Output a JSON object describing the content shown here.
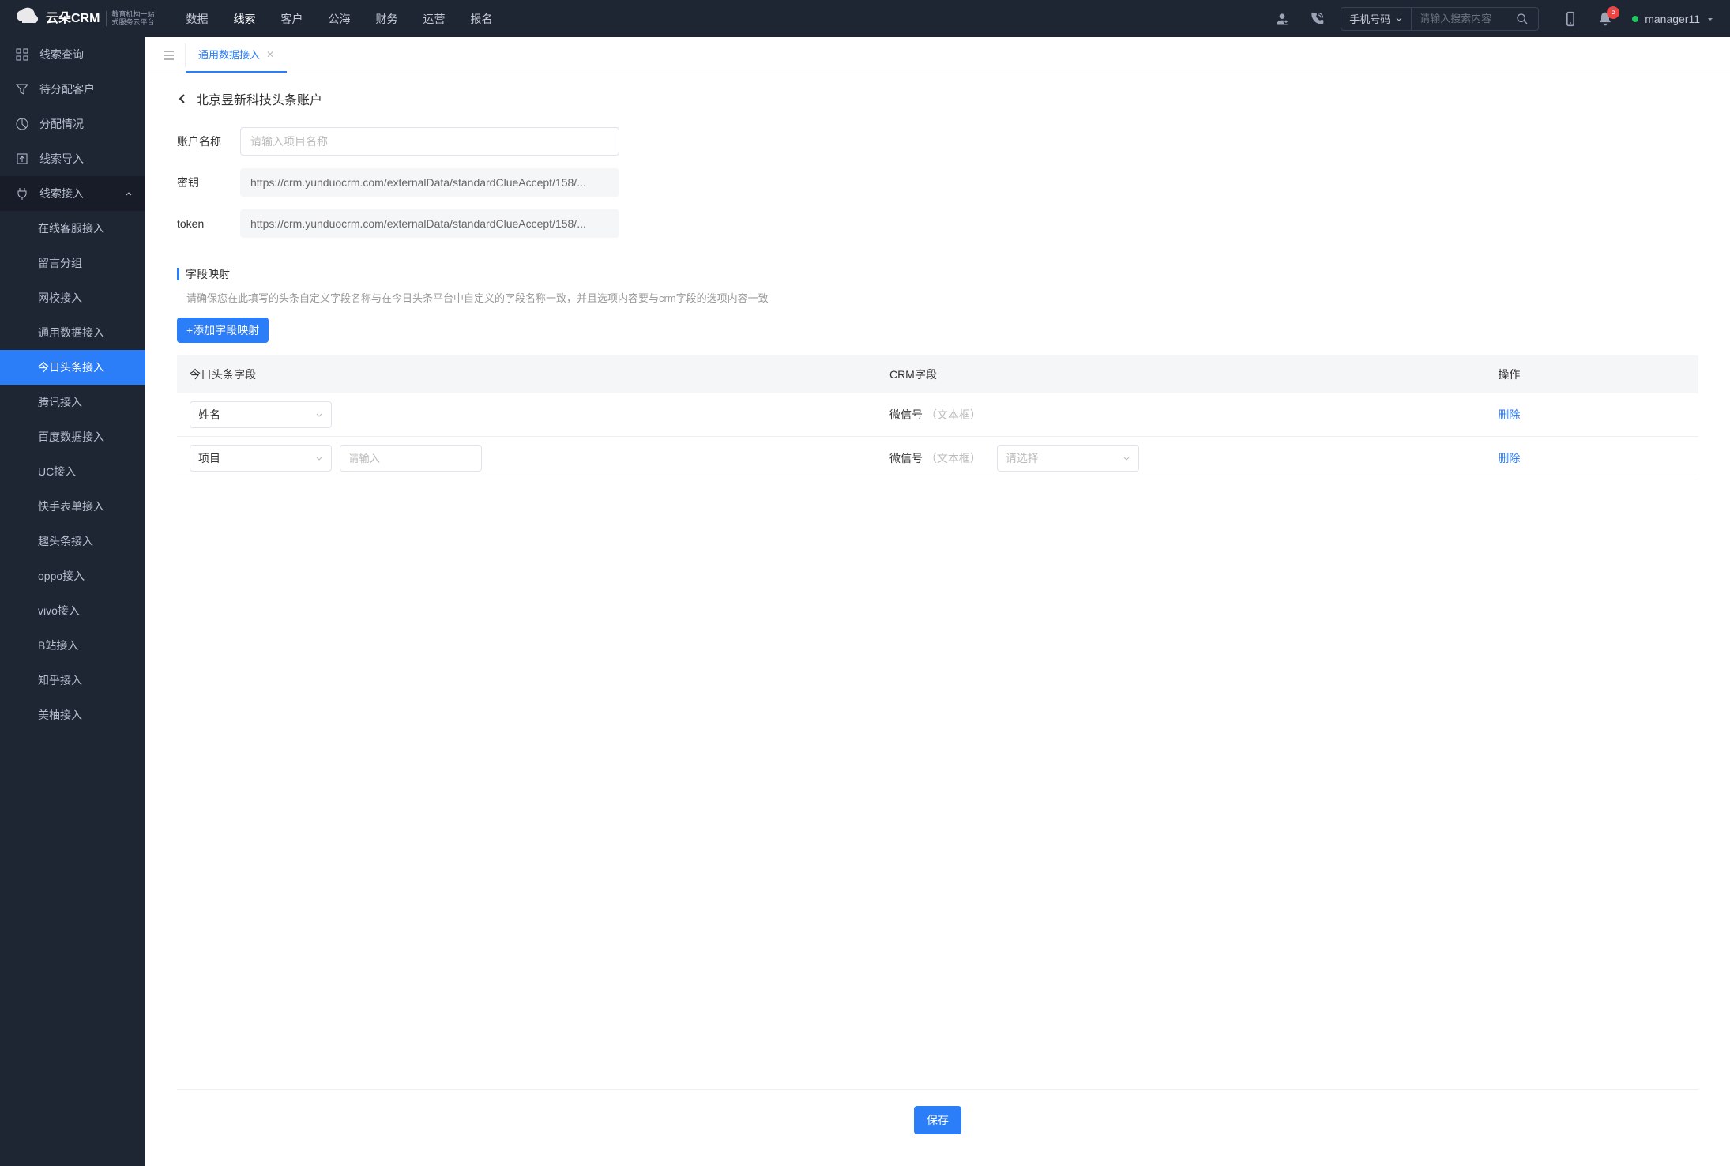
{
  "header": {
    "logo_main": "云朵CRM",
    "logo_sub1": "教育机构一站",
    "logo_sub2": "式服务云平台",
    "nav": [
      "数据",
      "线索",
      "客户",
      "公海",
      "财务",
      "运营",
      "报名"
    ],
    "nav_active": 1,
    "search_select": "手机号码",
    "search_placeholder": "请输入搜索内容",
    "notif_count": "5",
    "user": "manager11"
  },
  "sidebar": {
    "items": [
      {
        "label": "线索查询",
        "icon": "grid"
      },
      {
        "label": "待分配客户",
        "icon": "filter"
      },
      {
        "label": "分配情况",
        "icon": "pie"
      },
      {
        "label": "线索导入",
        "icon": "upload"
      },
      {
        "label": "线索接入",
        "icon": "plug",
        "expanded": true,
        "children": [
          {
            "label": "在线客服接入"
          },
          {
            "label": "留言分组"
          },
          {
            "label": "网校接入"
          },
          {
            "label": "通用数据接入"
          },
          {
            "label": "今日头条接入",
            "active": true
          },
          {
            "label": "腾讯接入"
          },
          {
            "label": "百度数据接入"
          },
          {
            "label": "UC接入"
          },
          {
            "label": "快手表单接入"
          },
          {
            "label": "趣头条接入"
          },
          {
            "label": "oppo接入"
          },
          {
            "label": "vivo接入"
          },
          {
            "label": "B站接入"
          },
          {
            "label": "知乎接入"
          },
          {
            "label": "美柚接入"
          }
        ]
      }
    ]
  },
  "tabs": {
    "active_tab": "通用数据接入"
  },
  "page": {
    "title": "北京昱新科技头条账户",
    "form": {
      "account_label": "账户名称",
      "account_placeholder": "请输入项目名称",
      "secret_label": "密钥",
      "secret_value": "https://crm.yunduocrm.com/externalData/standardClueAccept/158/...",
      "token_label": "token",
      "token_value": "https://crm.yunduocrm.com/externalData/standardClueAccept/158/..."
    },
    "mapping": {
      "section_title": "字段映射",
      "hint": "请确保您在此填写的头条自定义字段名称与在今日头条平台中自定义的字段名称一致，并且选项内容要与crm字段的选项内容一致",
      "add_button": "+添加字段映射",
      "columns": {
        "c1": "今日头条字段",
        "c2": "CRM字段",
        "c3": "操作"
      },
      "rows": [
        {
          "field_select": "姓名",
          "extra_input": null,
          "crm_name": "微信号",
          "crm_type": "（文本框）",
          "crm_select": null,
          "action": "删除"
        },
        {
          "field_select": "项目",
          "extra_input_placeholder": "请输入",
          "crm_name": "微信号",
          "crm_type": "（文本框）",
          "crm_select_placeholder": "请选择",
          "action": "删除"
        }
      ]
    },
    "save_button": "保存"
  }
}
